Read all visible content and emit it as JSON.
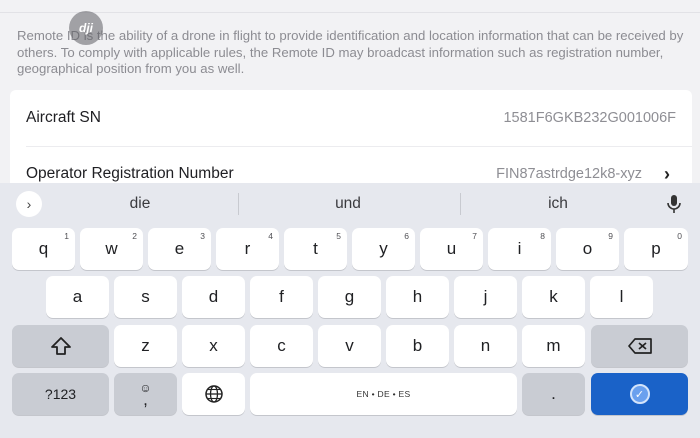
{
  "description": "Remote ID is the ability of a drone in flight to provide identification and location information that can be received by others. To comply with applicable rules, the Remote ID may broadcast information such as registration number, geographical position from you as well.",
  "logo_text": "dji",
  "rows": [
    {
      "label": "Aircraft SN",
      "value": "1581F6GKB232G001006F"
    },
    {
      "label": "Operator Registration Number",
      "value": "FIN87astrdge12k8-xyz",
      "chevron": "›"
    }
  ],
  "keyboard": {
    "suggestions": [
      "die",
      "und",
      "ich"
    ],
    "expand_icon": "›",
    "row1": [
      {
        "key": "q",
        "hint": "1"
      },
      {
        "key": "w",
        "hint": "2"
      },
      {
        "key": "e",
        "hint": "3"
      },
      {
        "key": "r",
        "hint": "4"
      },
      {
        "key": "t",
        "hint": "5"
      },
      {
        "key": "y",
        "hint": "6"
      },
      {
        "key": "u",
        "hint": "7"
      },
      {
        "key": "i",
        "hint": "8"
      },
      {
        "key": "o",
        "hint": "9"
      },
      {
        "key": "p",
        "hint": "0"
      }
    ],
    "row2": [
      "a",
      "s",
      "d",
      "f",
      "g",
      "h",
      "j",
      "k",
      "l"
    ],
    "row3": [
      "z",
      "x",
      "c",
      "v",
      "b",
      "n",
      "m"
    ],
    "symbols_label": "?123",
    "emoji_face": "☺",
    "comma_label": ",",
    "space_label": "EN • DE • ES",
    "period_label": ".",
    "shift_icon": "shift-icon",
    "backspace_icon": "backspace-icon",
    "globe_icon": "globe-icon",
    "mic_icon": "mic-icon",
    "enter_icon": "checkmark-icon",
    "enter_glyph": "✓",
    "accent": "#1a62c8"
  }
}
